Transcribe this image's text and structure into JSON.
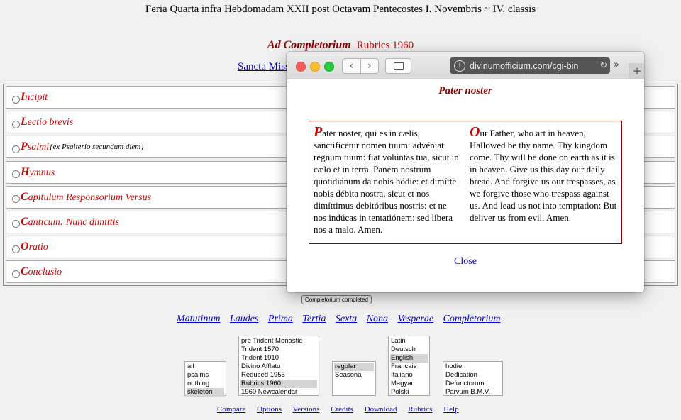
{
  "header": {
    "title": "Feria Quarta infra Hebdomadam XXII post Octavam Pentecostes I. Novembris ~ IV. classis",
    "hour": "Ad Completorium",
    "rubrics": "Rubrics 1960",
    "sancta_link": "Sancta Missa"
  },
  "sections": [
    {
      "initial": "I",
      "rest": "ncipit",
      "note": ""
    },
    {
      "initial": "L",
      "rest": "ectio brevis",
      "note": ""
    },
    {
      "initial": "P",
      "rest": "salmi",
      "note": "{ex Psalterio secundum diem}"
    },
    {
      "initial": "H",
      "rest": "ymnus",
      "note": ""
    },
    {
      "initial": "C",
      "rest": "apitulum Responsorium Versus",
      "note": ""
    },
    {
      "initial": "C",
      "rest": "anticum: Nunc dimittis",
      "note": ""
    },
    {
      "initial": "O",
      "rest": "ratio",
      "note": ""
    },
    {
      "initial": "C",
      "rest": "onclusio",
      "note": ""
    }
  ],
  "completed_button": "Completorium completed",
  "hours_nav": [
    "Matutinum",
    "Laudes",
    "Prima",
    "Tertia",
    "Sexta",
    "Nona",
    "Vesperae",
    "Completorium"
  ],
  "selects": {
    "mode": {
      "options": [
        "all",
        "psalms",
        "nothing",
        "skeleton"
      ],
      "selected": "skeleton"
    },
    "version": {
      "options": [
        "pre Trident Monastic",
        "Trident 1570",
        "Trident 1910",
        "Divino Afflatu",
        "Reduced 1955",
        "Rubrics 1960",
        "1960 Newcalendar"
      ],
      "selected": "Rubrics 1960"
    },
    "style": {
      "options": [
        "regular",
        "Seasonal"
      ],
      "selected": "regular"
    },
    "language": {
      "options": [
        "Latin",
        "Deutsch",
        "English",
        "Francais",
        "Italiano",
        "Magyar",
        "Polski"
      ],
      "selected": "English"
    },
    "votive": {
      "options": [
        "hodie",
        "Dedication",
        "Defunctorum",
        "Parvum B.M.V."
      ],
      "selected": ""
    }
  },
  "footer_links": [
    "Compare",
    "Options",
    "Versions",
    "Credits",
    "Download",
    "Rubrics",
    "Help"
  ],
  "popup": {
    "url": "divinumofficium.com/cgi-bin",
    "heading": "Pater noster",
    "latin_initial": "P",
    "latin_text": "ater noster, qui es in cælis, sanctificétur nomen tuum: advéniat regnum tuum: fiat volúntas tua, sicut in cælo et in terra. Panem nostrum quotidiánum da nobis hódie: et dimítte nobis débita nostra, sicut et nos dimíttimus debitóribus nostris: et ne nos indúcas in tentatiónem: sed líbera nos a malo. Amen.",
    "english_initial": "O",
    "english_text": "ur Father, who art in heaven, Hallowed be thy name. Thy kingdom come. Thy will be done on earth as it is in heaven. Give us this day our daily bread. And forgive us our trespasses, as we forgive those who trespass against us. And lead us not into temptation: But deliver us from evil. Amen.",
    "close": "Close"
  }
}
